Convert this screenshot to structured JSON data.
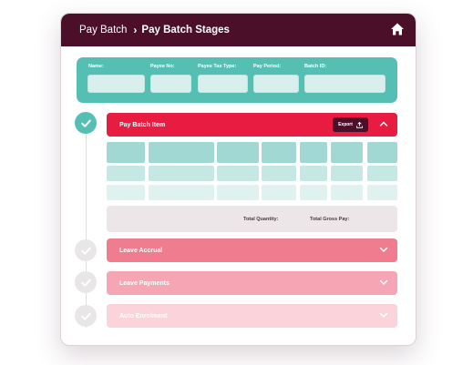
{
  "header": {
    "breadcrumb_root": "Pay Batch",
    "breadcrumb_separator": "›",
    "breadcrumb_current": "Pay Batch Stages",
    "home_icon": "home-icon"
  },
  "filters": {
    "fields": [
      {
        "label": "Name:",
        "value": ""
      },
      {
        "label": "Payee No:",
        "value": ""
      },
      {
        "label": "Payee Tax Type:",
        "value": ""
      },
      {
        "label": "Pay Period:",
        "value": ""
      },
      {
        "label": "Batch ID:",
        "value": ""
      }
    ]
  },
  "stages": [
    {
      "label": "Pay Batch Item",
      "state": "expanded",
      "completed": true
    },
    {
      "label": "Leave Accrual",
      "state": "collapsed",
      "completed": false
    },
    {
      "label": "Leave Payments",
      "state": "collapsed",
      "completed": false
    },
    {
      "label": "Auto Enrolment",
      "state": "collapsed",
      "completed": false
    }
  ],
  "pay_batch_item": {
    "export_label": "Export",
    "total_quantity_label": "Total Quantity:",
    "total_gross_pay_label": "Total Gross Pay:"
  },
  "colors": {
    "header_bg": "#4c0f2a",
    "teal": "#55bfb4",
    "stage_active": "#e81b41",
    "stage_2": "#f07c8f",
    "stage_3": "#f5a5b3",
    "stage_4": "#fad4da"
  }
}
